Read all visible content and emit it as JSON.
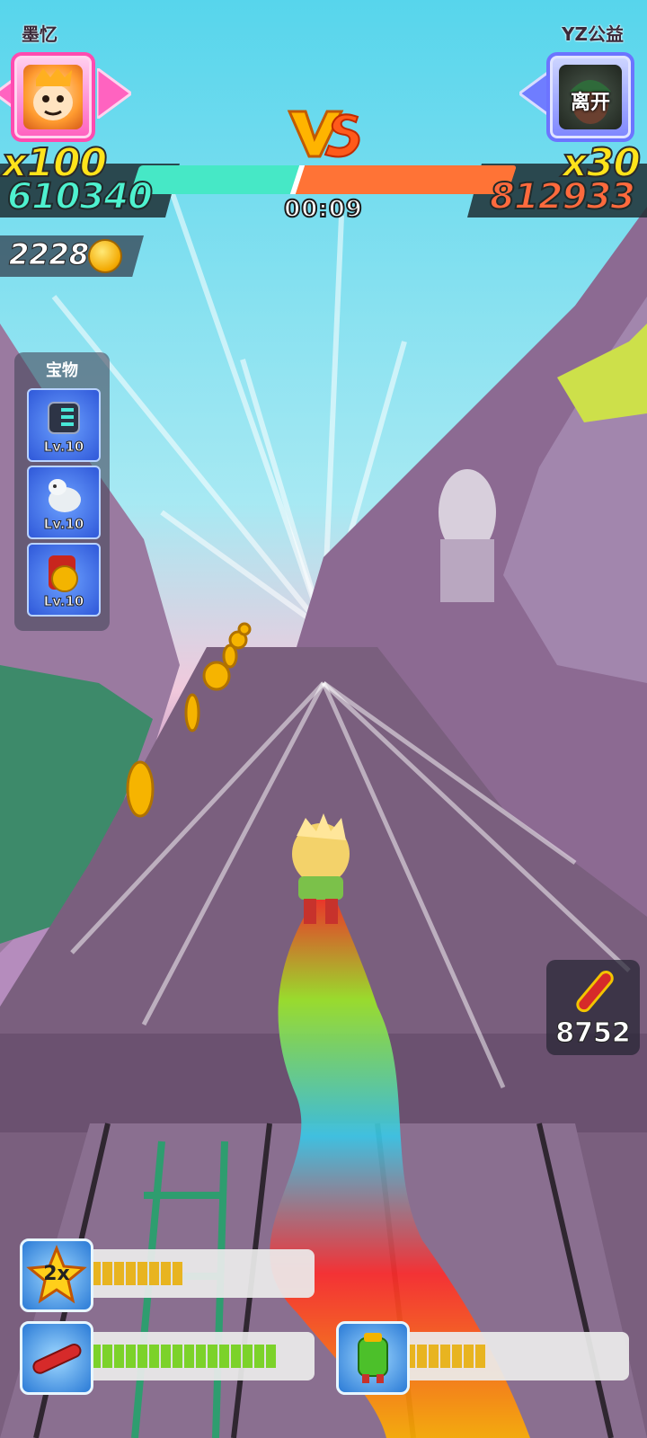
{
  "player1": {
    "name": "墨忆",
    "multiplier": "x100",
    "score": "610340",
    "accent": "#4ef1cf"
  },
  "player2": {
    "name": "YZ公益",
    "multiplier": "x30",
    "score": "812933",
    "portrait_label": "离开",
    "accent": "#ff6a3d"
  },
  "versus": {
    "left_share": 0.43,
    "timer": "00:09"
  },
  "coins": {
    "count": "2228",
    "icon": "coin-icon"
  },
  "treasure": {
    "title": "宝物",
    "items": [
      {
        "icon": "jetpack-gadget-icon",
        "level": "Lv.10"
      },
      {
        "icon": "white-goat-pet-icon",
        "level": "Lv.10"
      },
      {
        "icon": "lucky-coin-bag-icon",
        "level": "Lv.10"
      }
    ]
  },
  "hoverboard": {
    "icon": "hoverboard-icon",
    "count": "8752"
  },
  "powerups": [
    {
      "icon": "double-score-star-icon",
      "label": "2x",
      "level": 9,
      "max": 20,
      "color": "#e8b420"
    },
    {
      "icon": "hoverboard-icon",
      "level": 17,
      "max": 20,
      "color": "#7cd22a"
    },
    {
      "icon": "jetpack-icon",
      "level": 8,
      "max": 20,
      "color": "#e8b420"
    }
  ]
}
